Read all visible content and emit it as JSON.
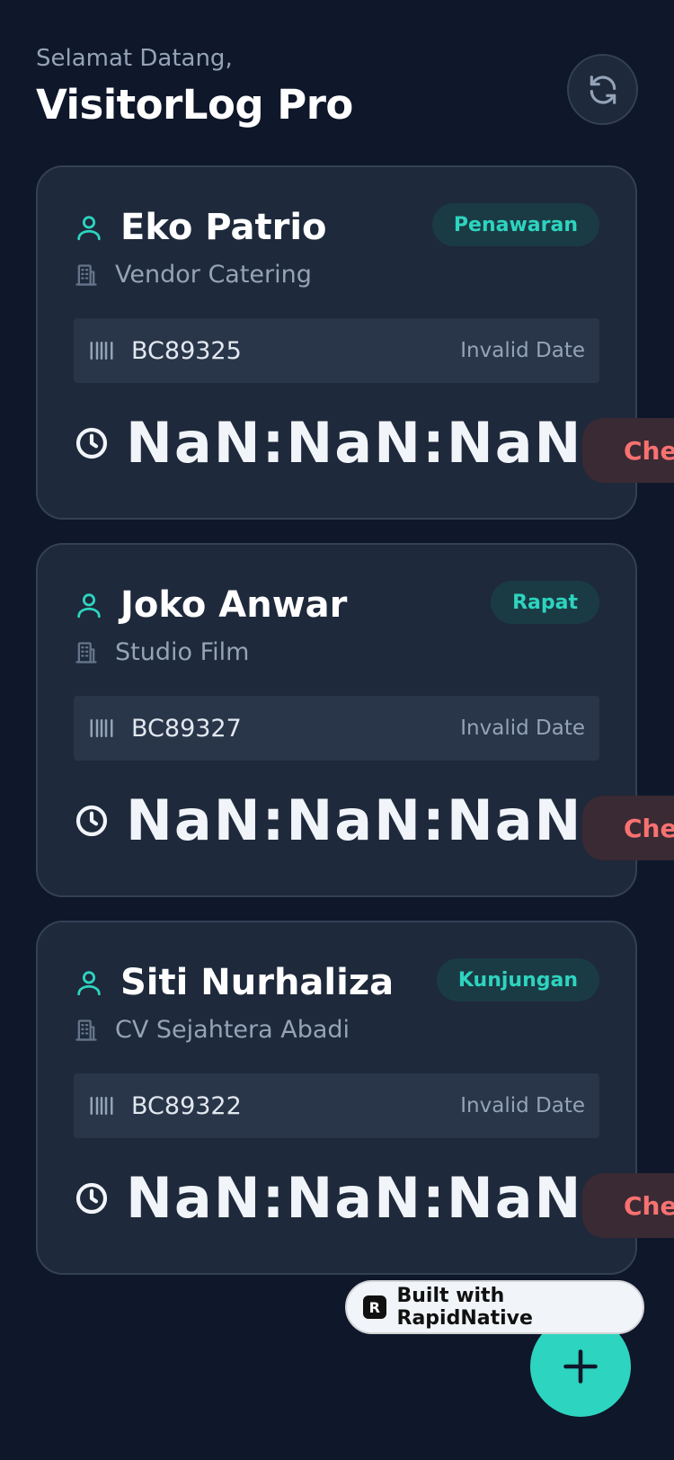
{
  "header": {
    "greeting": "Selamat Datang,",
    "title": "VisitorLog Pro",
    "refresh_icon": "refresh-icon"
  },
  "visitors": [
    {
      "name": "Eko Patrio",
      "badge": "Penawaran",
      "company": "Vendor Catering",
      "code": "BC89325",
      "date": "Invalid Date",
      "timer": "NaN:NaN:NaN",
      "checkout_label": "Check Out"
    },
    {
      "name": "Joko Anwar",
      "badge": "Rapat",
      "company": "Studio Film",
      "code": "BC89327",
      "date": "Invalid Date",
      "timer": "NaN:NaN:NaN",
      "checkout_label": "Check Out"
    },
    {
      "name": "Siti Nurhaliza",
      "badge": "Kunjungan",
      "company": "CV Sejahtera Abadi",
      "code": "BC89322",
      "date": "Invalid Date",
      "timer": "NaN:NaN:NaN",
      "checkout_label": "Check Out"
    }
  ],
  "footer": {
    "built_with": "Built with RapidNative",
    "logo_letter": "R",
    "fab_icon": "plus-icon"
  },
  "colors": {
    "background": "#0f172a",
    "card": "#1e293b",
    "accent": "#2dd4bf",
    "danger": "#f87171"
  }
}
